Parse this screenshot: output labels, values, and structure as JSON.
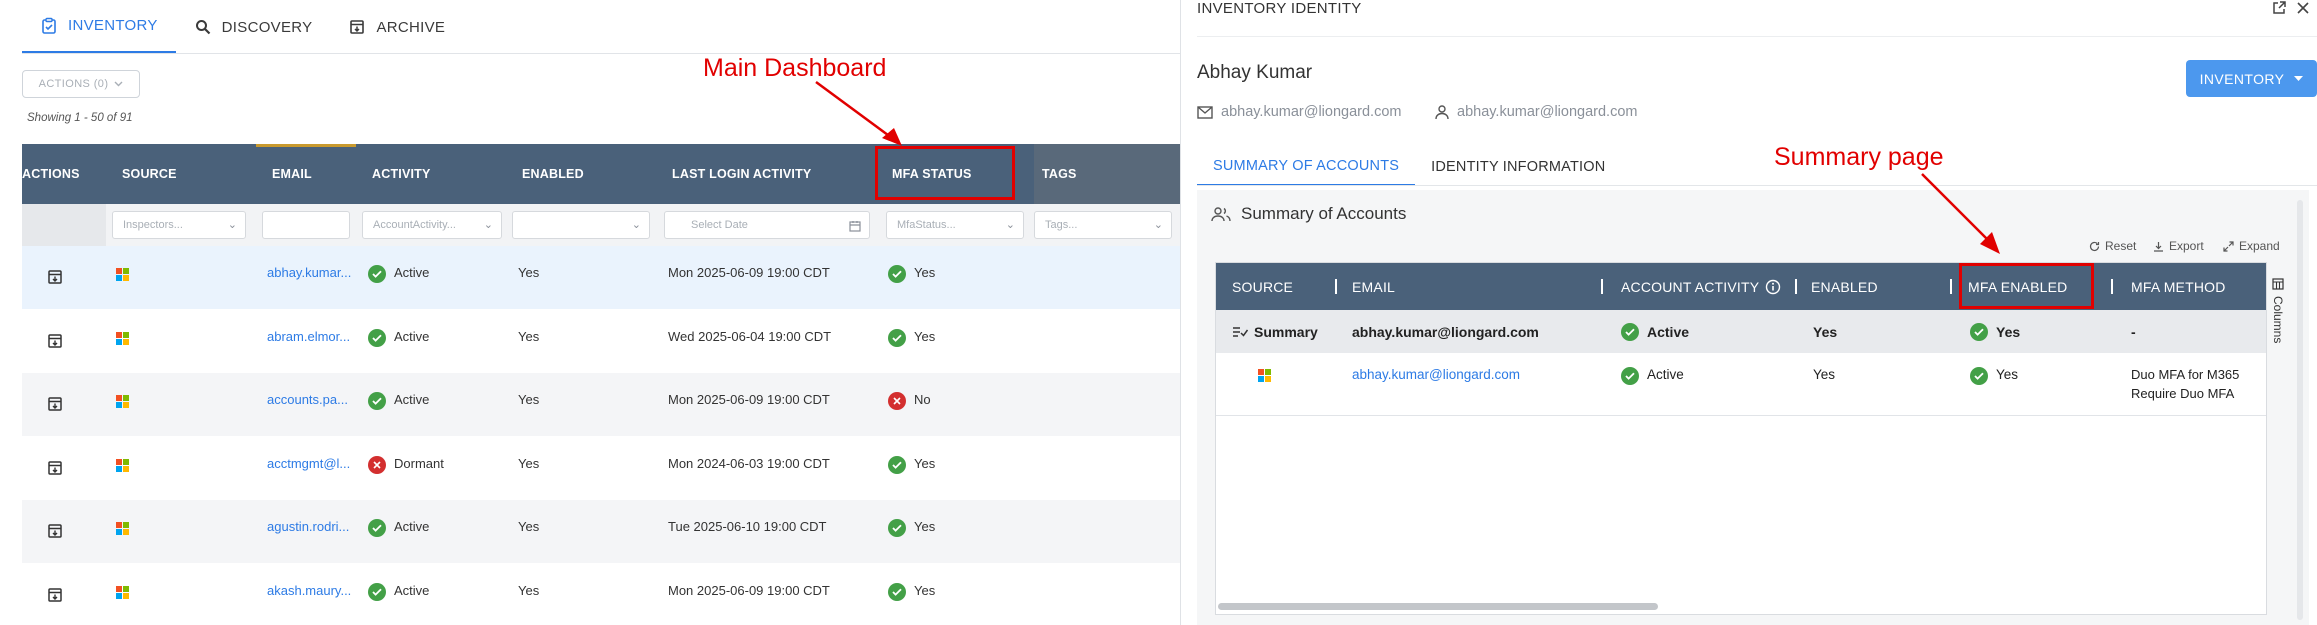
{
  "dashboard": {
    "tabs": [
      {
        "label": "INVENTORY",
        "icon": "inventory-icon"
      },
      {
        "label": "DISCOVERY",
        "icon": "search-icon"
      },
      {
        "label": "ARCHIVE",
        "icon": "archive-icon"
      }
    ],
    "actions_label": "ACTIONS (0)",
    "showing_text": "Showing 1 - 50 of 91",
    "columns": [
      "ACTIONS",
      "SOURCE",
      "EMAIL",
      "ACTIVITY",
      "ENABLED",
      "LAST LOGIN ACTIVITY",
      "MFA STATUS",
      "TAGS"
    ],
    "filters": {
      "source": "Inspectors...",
      "email": "",
      "activity": "AccountActivity...",
      "enabled": "",
      "last_login": "Select Date",
      "mfa": "MfaStatus...",
      "tags": "Tags..."
    },
    "rows": [
      {
        "email": "abhay.kumar...",
        "activity": "Active",
        "enabled": "Yes",
        "last_login": "Mon 2025-06-09 19:00 CDT",
        "mfa": "Yes"
      },
      {
        "email": "abram.elmor...",
        "activity": "Active",
        "enabled": "Yes",
        "last_login": "Wed 2025-06-04 19:00 CDT",
        "mfa": "Yes"
      },
      {
        "email": "accounts.pa...",
        "activity": "Active",
        "enabled": "Yes",
        "last_login": "Mon 2025-06-09 19:00 CDT",
        "mfa": "No"
      },
      {
        "email": "acctmgmt@l...",
        "activity": "Dormant",
        "enabled": "Yes",
        "last_login": "Mon 2024-06-03 19:00 CDT",
        "mfa": "Yes"
      },
      {
        "email": "agustin.rodri...",
        "activity": "Active",
        "enabled": "Yes",
        "last_login": "Tue 2025-06-10 19:00 CDT",
        "mfa": "Yes"
      },
      {
        "email": "akash.maury...",
        "activity": "Active",
        "enabled": "Yes",
        "last_login": "Mon 2025-06-09 19:00 CDT",
        "mfa": "Yes"
      }
    ],
    "annotation": "Main Dashboard"
  },
  "panel": {
    "title": "INVENTORY IDENTITY",
    "name": "Abhay Kumar",
    "email": "abhay.kumar@liongard.com",
    "username": "abhay.kumar@liongard.com",
    "inventory_button": "INVENTORY",
    "tabs": [
      "SUMMARY OF ACCOUNTS",
      "IDENTITY INFORMATION"
    ],
    "summary_title": "Summary of Accounts",
    "tools": [
      "Reset",
      "Export",
      "Expand"
    ],
    "columns": [
      "SOURCE",
      "EMAIL",
      "ACCOUNT ACTIVITY",
      "ENABLED",
      "MFA ENABLED",
      "MFA METHOD"
    ],
    "columns_side_label": "Columns",
    "summary_row": {
      "label": "Summary",
      "email": "abhay.kumar@liongard.com",
      "activity": "Active",
      "enabled": "Yes",
      "mfa": "Yes",
      "method": "-"
    },
    "detail_row": {
      "email": "abhay.kumar@liongard.com",
      "activity": "Active",
      "enabled": "Yes",
      "mfa": "Yes",
      "method_line1": "Duo MFA for M365",
      "method_line2": "Require Duo MFA"
    },
    "annotation": "Summary page"
  },
  "colors": {
    "accent": "#2d7be5",
    "header": "#4a617a",
    "success": "#43a047",
    "danger": "#d32f2f",
    "annotation": "#e10000"
  }
}
